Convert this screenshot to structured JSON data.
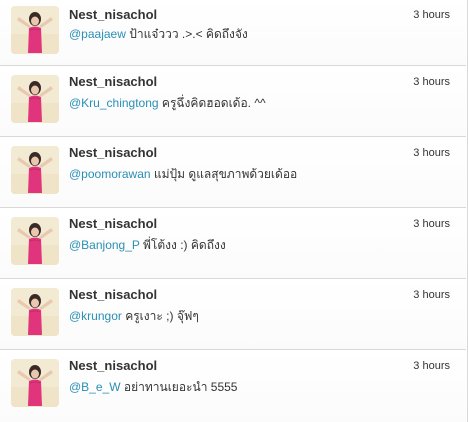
{
  "tweets": [
    {
      "username": "Nest_nisachol",
      "time": "3 hours",
      "mention": "@paajaew",
      "text": " ป้าแจ๋ววว .>.< คิดถึงจัง"
    },
    {
      "username": "Nest_nisachol",
      "time": "3 hours",
      "mention": "@Kru_chingtong",
      "text": " ครูฉึ่งคิดฮอดเด้อ. ^^"
    },
    {
      "username": "Nest_nisachol",
      "time": "3 hours",
      "mention": "@poomorawan",
      "text": " แม่ปุ้ม ดูแลสุขภาพด้วยเด้ออ"
    },
    {
      "username": "Nest_nisachol",
      "time": "3 hours",
      "mention": "@Banjong_P",
      "text": " พี่โต้งง :) คิดถึงง"
    },
    {
      "username": "Nest_nisachol",
      "time": "3 hours",
      "mention": "@krungor",
      "text": " ครูเงาะ ;) จุ๊ฟๆ"
    },
    {
      "username": "Nest_nisachol",
      "time": "3 hours",
      "mention": "@B_e_W",
      "text": " อย่าทานเยอะนำ 5555"
    }
  ]
}
